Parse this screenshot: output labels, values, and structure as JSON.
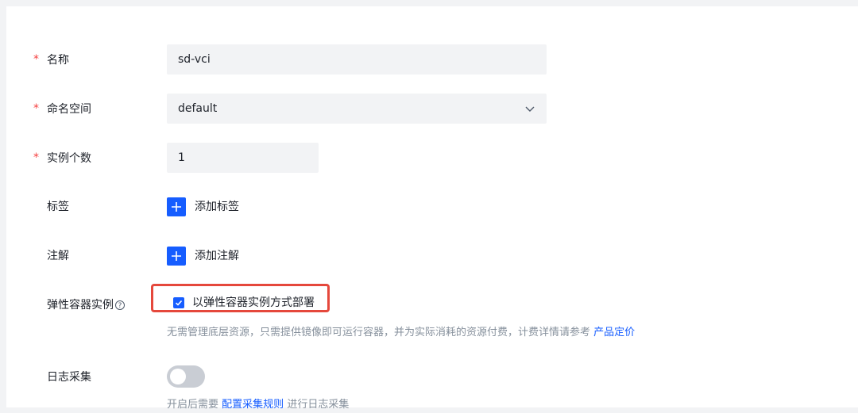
{
  "form": {
    "name": {
      "required_mark": "*",
      "label": "名称",
      "value": "sd-vci"
    },
    "namespace": {
      "required_mark": "*",
      "label": "命名空间",
      "value": "default"
    },
    "replicas": {
      "required_mark": "*",
      "label": "实例个数",
      "value": "1"
    },
    "tags": {
      "label": "标签",
      "add_label": "添加标签"
    },
    "annotations": {
      "label": "注解",
      "add_label": "添加注解"
    },
    "elastic": {
      "label": "弹性容器实例",
      "help_icon": "?",
      "checkbox_label": "以弹性容器实例方式部署",
      "checked": true,
      "desc_text": "无需管理底层资源，只需提供镜像即可运行容器，并为实际消耗的资源付费，计费详情请参考",
      "desc_link": "产品定价"
    },
    "log": {
      "label": "日志采集",
      "enabled": false,
      "desc_prefix": "开启后需要",
      "desc_link": "配置采集规则",
      "desc_suffix": "进行日志采集"
    }
  },
  "colors": {
    "primary": "#165dff",
    "required": "#f53f3f",
    "highlight_border": "#e5483c"
  },
  "icons": {
    "namespace_dropdown": "chevron-down-icon",
    "add": "plus-icon",
    "check": "check-icon",
    "help": "question-circle-icon"
  }
}
